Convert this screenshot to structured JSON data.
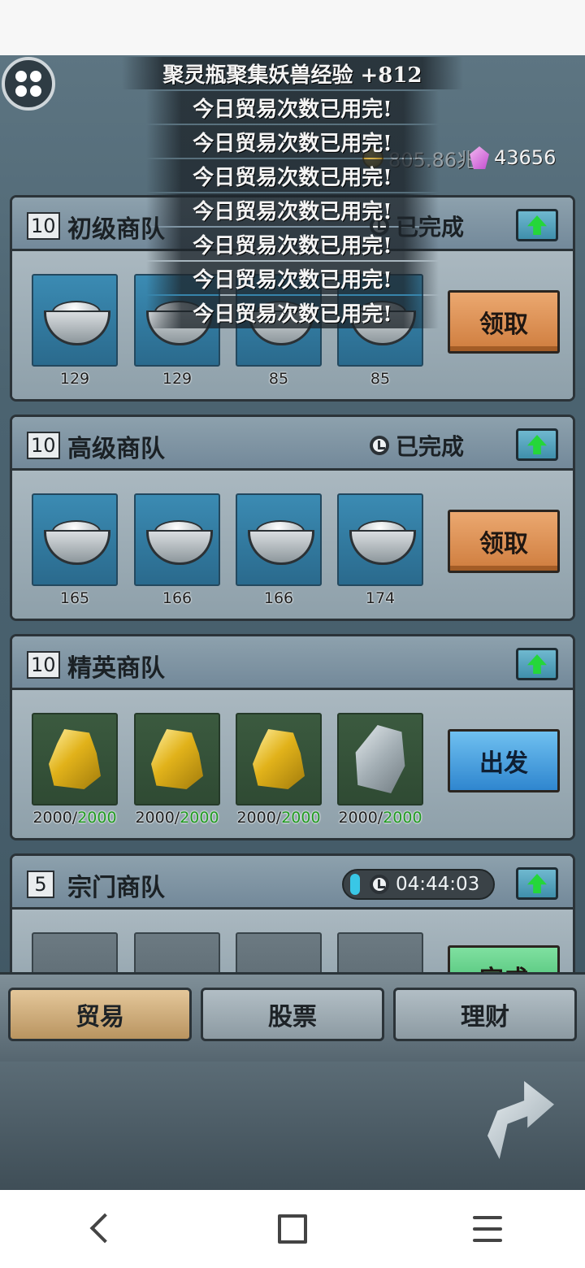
{
  "toasts": {
    "first": "聚灵瓶聚集妖兽经验 +812",
    "repeat": [
      "今日贸易次数已用完!",
      "今日贸易次数已用完!",
      "今日贸易次数已用完!",
      "今日贸易次数已用完!",
      "今日贸易次数已用完!",
      "今日贸易次数已用完!",
      "今日贸易次数已用完!"
    ]
  },
  "currency": {
    "coins": "805.86兆",
    "gems": "43656"
  },
  "panels": [
    {
      "level": "10",
      "title": "初级商队",
      "status": "已完成",
      "action": "领取",
      "slots": [
        {
          "item": "silver-ingot",
          "qty": "129"
        },
        {
          "item": "silver-ingot",
          "qty": "129"
        },
        {
          "item": "silver-ingot",
          "qty": "85"
        },
        {
          "item": "silver-ingot",
          "qty": "85"
        }
      ]
    },
    {
      "level": "10",
      "title": "高级商队",
      "status": "已完成",
      "action": "领取",
      "slots": [
        {
          "item": "silver-ingot",
          "qty": "165"
        },
        {
          "item": "silver-ingot",
          "qty": "166"
        },
        {
          "item": "silver-ingot",
          "qty": "166"
        },
        {
          "item": "silver-ingot",
          "qty": "174"
        }
      ]
    },
    {
      "level": "10",
      "title": "精英商队",
      "action": "出发",
      "slots": [
        {
          "item": "gold-ore",
          "have": "2000/",
          "need": "2000"
        },
        {
          "item": "gold-ore",
          "have": "2000/",
          "need": "2000"
        },
        {
          "item": "gold-ore",
          "have": "2000/",
          "need": "2000"
        },
        {
          "item": "stone",
          "have": "2000/",
          "need": "2000"
        }
      ]
    },
    {
      "level": "5",
      "title": "宗门商队",
      "timer": "04:44:03",
      "action": "完成"
    }
  ],
  "tabs": {
    "trade": "贸易",
    "stocks": "股票",
    "finance": "理财"
  },
  "colors": {
    "accent_green": "#25d63a",
    "action_orange": "#cf7d3e",
    "slot_blue": "#2a6a8d"
  }
}
